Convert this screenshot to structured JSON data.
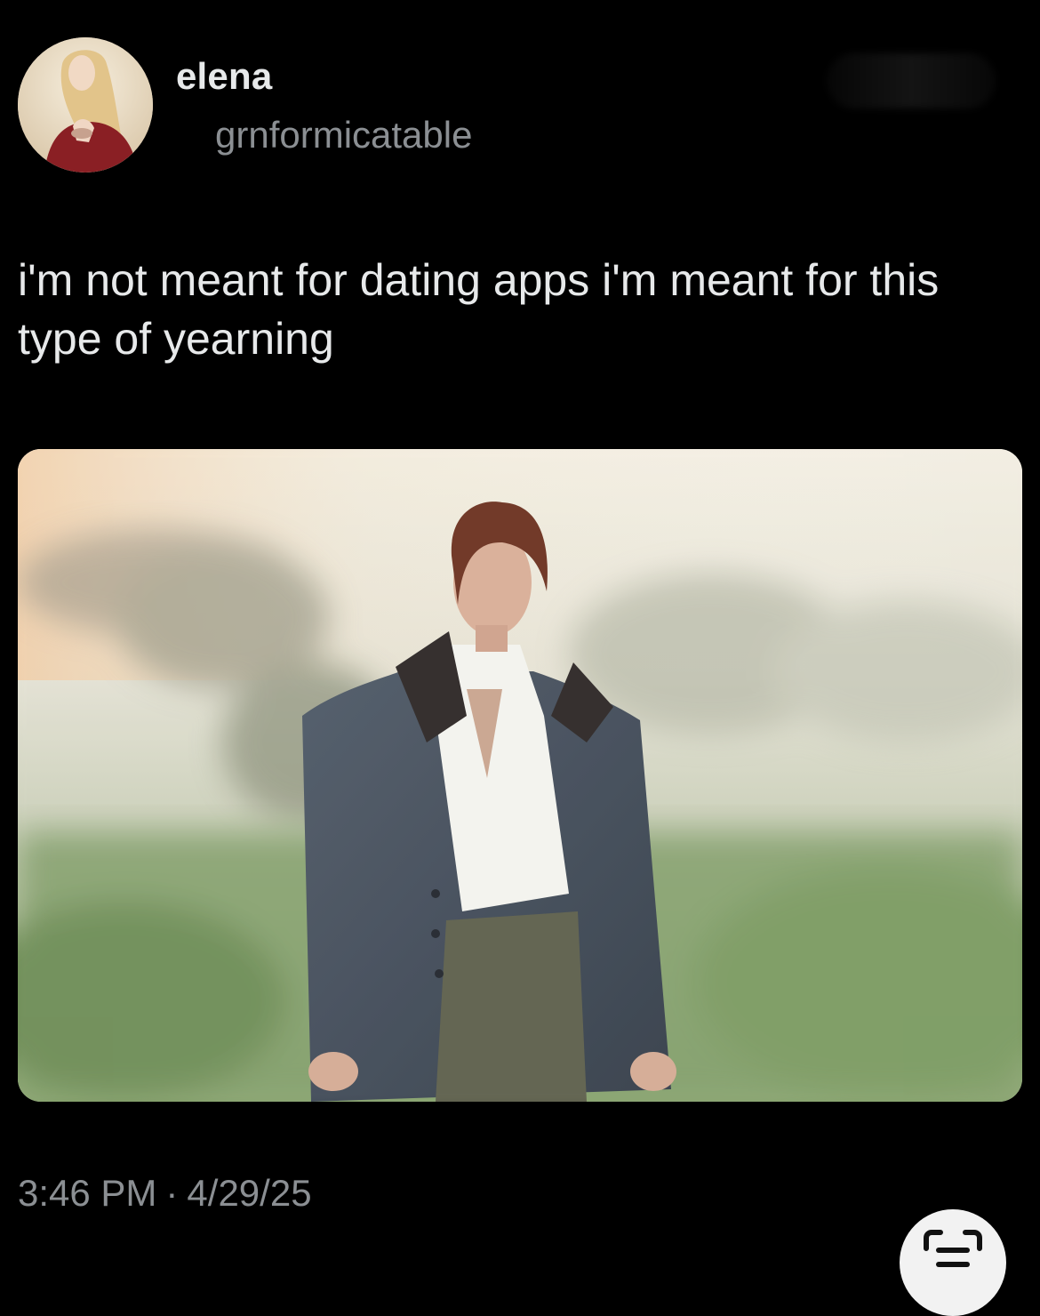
{
  "author": {
    "display_name": "elena",
    "handle": "grnformicatable",
    "avatar_icon": "profile-photo"
  },
  "tweet": {
    "text": "i'm not meant for dating apps i'm meant for this type of yearning"
  },
  "media": {
    "description_icon": "photo"
  },
  "meta": {
    "time": "3:46 PM",
    "separator": "·",
    "date": "4/29/25"
  },
  "colors": {
    "background": "#000000",
    "primary_text": "#e7e9ea",
    "secondary_text": "#8b8f93"
  },
  "fab": {
    "icon": "scan-text-icon"
  }
}
